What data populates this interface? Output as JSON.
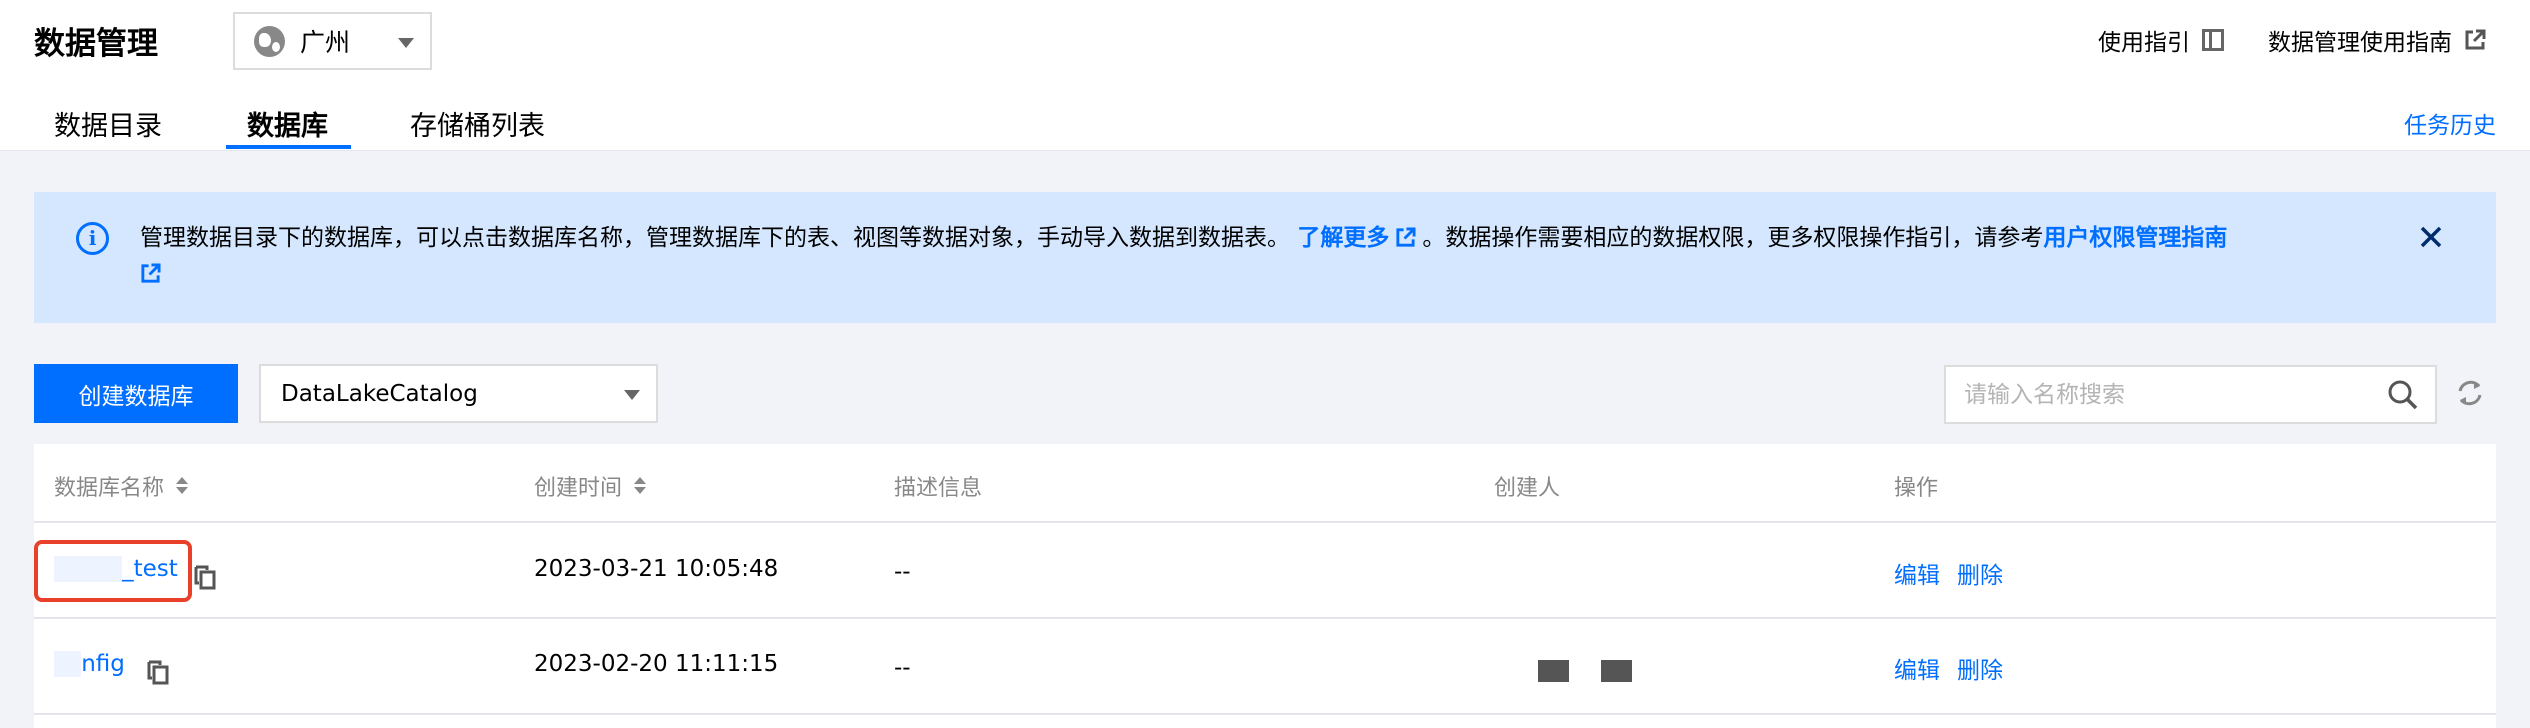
{
  "header": {
    "title": "数据管理",
    "region": "广州",
    "usage_guide": "使用指引",
    "manual_link": "数据管理使用指南"
  },
  "tabs": [
    {
      "label": "数据目录",
      "active": false
    },
    {
      "label": "数据库",
      "active": true
    },
    {
      "label": "存储桶列表",
      "active": false
    }
  ],
  "task_history": "任务历史",
  "notice": {
    "text_1": "管理数据目录下的数据库，可以点击数据库名称，管理数据库下的表、视图等数据对象，手动导入数据到数据表。",
    "link_1": "了解更多",
    "text_2": "。数据操作需要相应的数据权限，更多权限操作指引，请参考",
    "link_2": "用户权限管理指南"
  },
  "toolbar": {
    "create_label": "创建数据库",
    "catalog_value": "DataLakeCatalog",
    "search_placeholder": "请输入名称搜索"
  },
  "table": {
    "columns": [
      "数据库名称",
      "创建时间",
      "描述信息",
      "创建人",
      "操作"
    ],
    "rows": [
      {
        "name": "_test",
        "created": "2023-03-21 10:05:48",
        "desc": "--",
        "edit": "编辑",
        "delete": "删除"
      },
      {
        "name": "nfig",
        "created": "2023-02-20 11:11:15",
        "desc": "--",
        "edit": "编辑",
        "delete": "删除"
      }
    ]
  },
  "colors": {
    "accent": "#006eff",
    "notice_bg": "#d5e7ff",
    "highlight": "#e8402a"
  }
}
